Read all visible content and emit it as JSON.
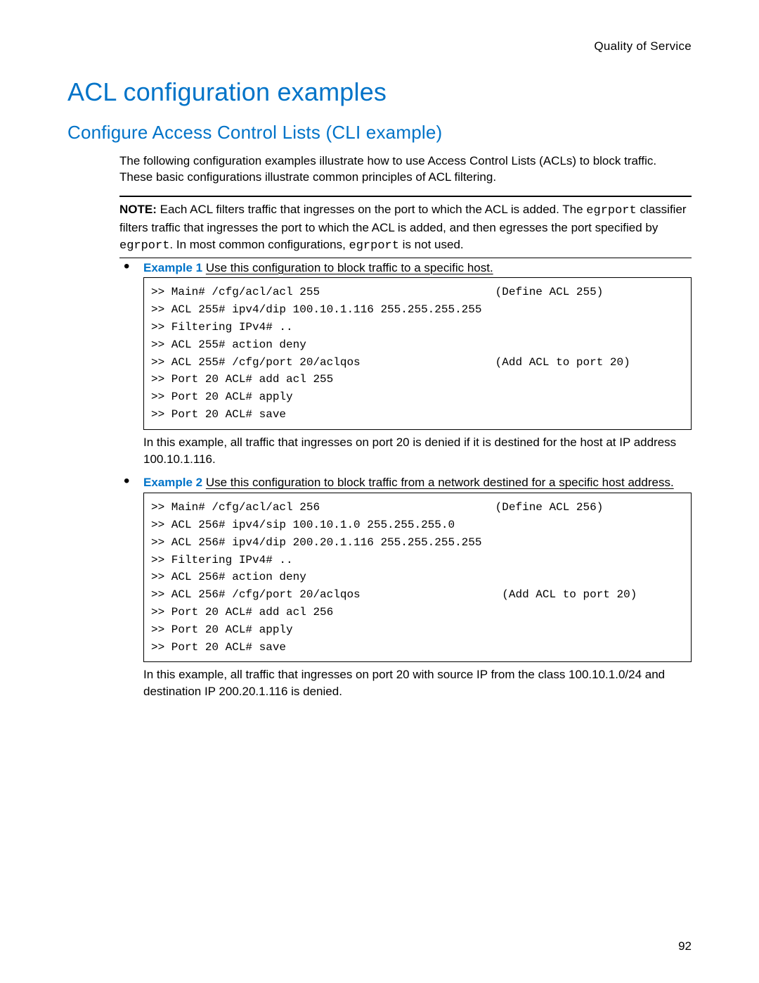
{
  "header": {
    "right": "Quality of Service"
  },
  "title": "ACL configuration examples",
  "subtitle": "Configure Access Control Lists (CLI example)",
  "intro": "The following configuration examples illustrate how to use Access Control Lists (ACLs) to block traffic. These basic configurations illustrate common principles of ACL filtering.",
  "note": {
    "label": "NOTE:",
    "part1": "Each ACL filters traffic that ingresses on the port to which the ACL is added. The ",
    "code1": "egrport",
    "part2": " classifier filters traffic that ingresses the port to which the ACL is added, and then egresses the port specified by ",
    "code2": "egrport",
    "part3": ". In most common configurations, ",
    "code3": "egrport",
    "part4": " is not used."
  },
  "examples": [
    {
      "label": "Example 1",
      "desc": "Use this configuration to block traffic to a specific host.",
      "code": ">> Main# /cfg/acl/acl 255                          (Define ACL 255)\n>> ACL 255# ipv4/dip 100.10.1.116 255.255.255.255\n>> Filtering IPv4# ..\n>> ACL 255# action deny\n>> ACL 255# /cfg/port 20/aclqos                    (Add ACL to port 20)\n>> Port 20 ACL# add acl 255\n>> Port 20 ACL# apply\n>> Port 20 ACL# save",
      "explain": "In this example, all traffic that ingresses on port 20 is denied if it is destined for the host at IP address 100.10.1.116."
    },
    {
      "label": "Example 2",
      "desc": "Use this configuration to block traffic from a network destined for a specific host address.",
      "code": ">> Main# /cfg/acl/acl 256                          (Define ACL 256)\n>> ACL 256# ipv4/sip 100.10.1.0 255.255.255.0\n>> ACL 256# ipv4/dip 200.20.1.116 255.255.255.255\n>> Filtering IPv4# ..\n>> ACL 256# action deny\n>> ACL 256# /cfg/port 20/aclqos                     (Add ACL to port 20)\n>> Port 20 ACL# add acl 256\n>> Port 20 ACL# apply\n>> Port 20 ACL# save",
      "explain": "In this example, all traffic that ingresses on port 20 with source IP from the class 100.10.1.0/24 and destination IP 200.20.1.116 is denied."
    }
  ],
  "page_number": "92"
}
